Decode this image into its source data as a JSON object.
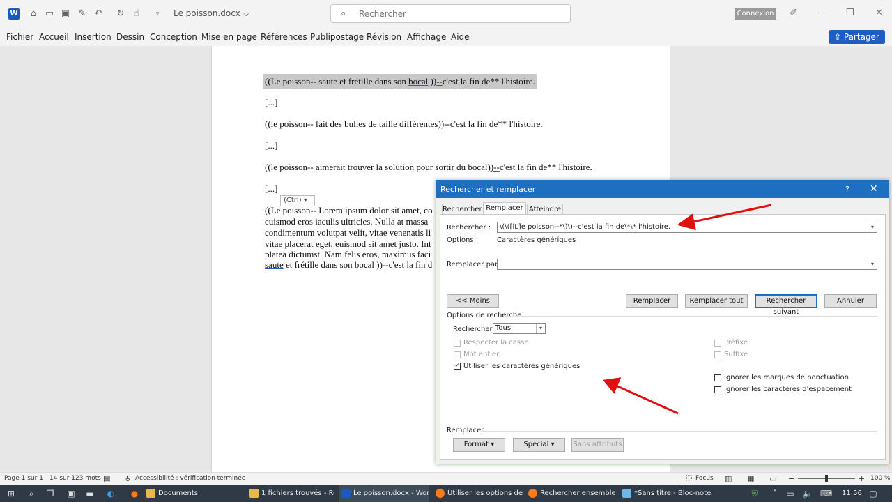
{
  "titlebar": {
    "doc_name": "Le poisson.docx ⌵",
    "search_placeholder": "Rechercher",
    "connexion": "Connexion"
  },
  "ribbon": {
    "tabs": [
      "Fichier",
      "Accueil",
      "Insertion",
      "Dessin",
      "Conception",
      "Mise en page",
      "Références",
      "Publipostage",
      "Révision",
      "Affichage",
      "Aide"
    ],
    "share": "Partager"
  },
  "document": {
    "p1a": "((Le poisson-- saute et frétille dans son ",
    "p1b": "bocal",
    "p1c": " ))",
    "p1d": "--",
    "p1e": "c'est la fin de** l'histoire.",
    "e1": "[...]",
    "p2a": "((le poisson-- fait des bulles de taille différentes))",
    "p2b": "--",
    "p2c": "c'est la fin de** l'histoire.",
    "e2": "[...]",
    "p3a": "((le poisson-- aimerait trouver la solution pour sortir du bocal",
    "p3b": "))--",
    "p3c": "c'est la fin de** l'histoire.",
    "e3": "[...]",
    "l1": "((Le poisson-- Lorem ipsum dolor sit amet, co",
    "l2": "euismod eros iaculis ultricies. Nulla at massa",
    "l3": "condimentum volutpat velit, vitae venenatis li",
    "l4": "vitae placerat eget, euismod sit amet justo. Int",
    "l5": "platea dictumst. Nam felis eros, maximus faci",
    "l6a": "saute",
    "l6b": " et frétille dans son bocal ))--c'est la fin d",
    "ctrl_tag": "(Ctrl) ▾"
  },
  "dialog": {
    "title": "Rechercher et remplacer",
    "help": "?",
    "close": "✕",
    "tabs": [
      "Rechercher",
      "Remplacer",
      "Atteindre"
    ],
    "find_label": "Rechercher :",
    "find_value": "\\(\\([lL]e poisson--*\\)\\)--c'est la fin de\\*\\* l'histoire.",
    "options_label": "Options :",
    "options_value": "Caractères génériques",
    "replace_label": "Remplacer par :",
    "replace_value": "",
    "btn_less": "<< Moins",
    "btn_replace": "Remplacer",
    "btn_replace_all": "Remplacer tout",
    "btn_find_next": "Rechercher suivant",
    "btn_cancel": "Annuler",
    "search_options_title": "Options de recherche",
    "search_label": "Rechercher :",
    "search_dir": "Tous",
    "chk_case": "Respecter la casse",
    "chk_whole": "Mot entier",
    "chk_wildcards": "Utiliser les caractères génériques",
    "chk_prefix": "Préfixe",
    "chk_suffix": "Suffixe",
    "chk_punct": "Ignorer les marques de ponctuation",
    "chk_space": "Ignorer les caractères d'espacement",
    "replace_section": "Remplacer",
    "btn_format": "Format ▾",
    "btn_special": "Spécial ▾",
    "btn_no_attr": "Sans attributs",
    "check_mark": "✓"
  },
  "statusbar": {
    "page": "Page 1 sur 1",
    "words": "14 sur 123 mots",
    "accessibility": "Accessibilité : vérification terminée",
    "focus": "Focus",
    "zoom": "100 %",
    "zoom_level": 100
  },
  "taskbar": {
    "items": [
      "Documents",
      "1 fichiers trouvés - Re...",
      "Le poisson.docx - Word",
      "Utiliser les options de ...",
      "Rechercher ensemble ...",
      "*Sans titre - Bloc-notes"
    ],
    "time": "11:56"
  },
  "colors": {
    "accent": "#1f6fc0",
    "share": "#1c5dc6",
    "arrow": "#e01010"
  }
}
